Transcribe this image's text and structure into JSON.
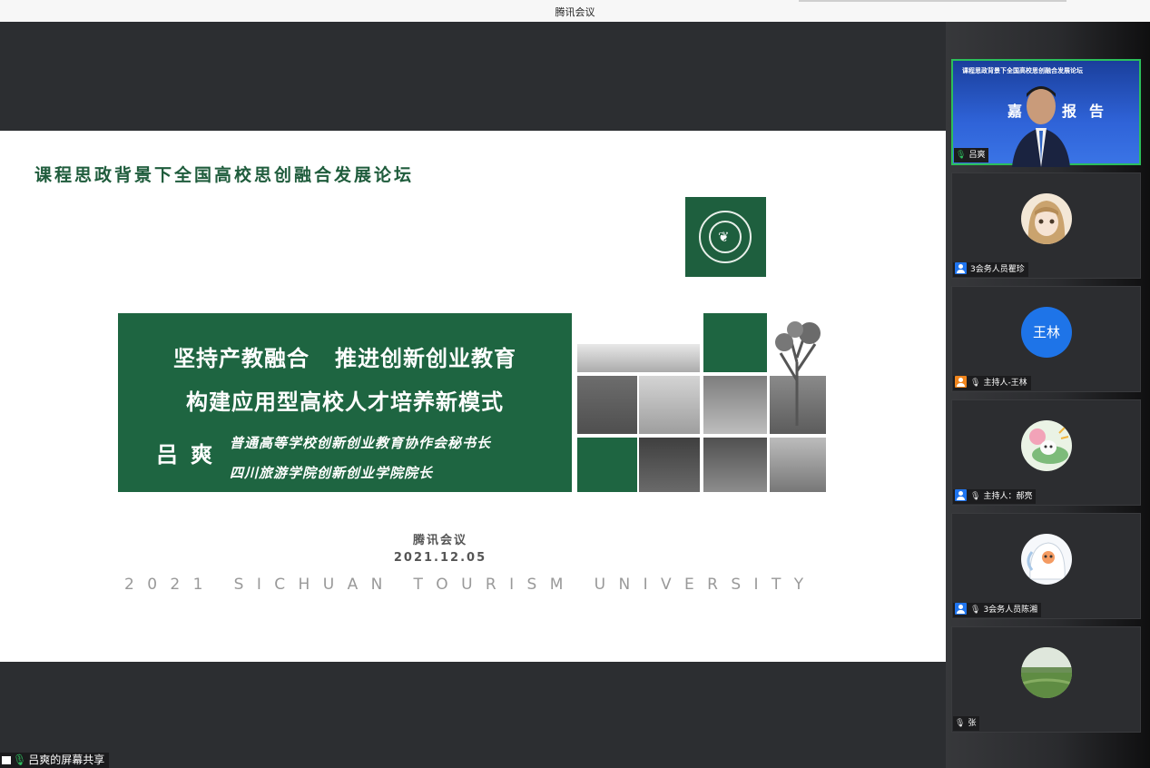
{
  "window": {
    "title": "腾讯会议"
  },
  "slide": {
    "forum_title": "课程思政背景下全国高校思创融合发展论坛",
    "headline_1": "坚持产教融合   推进创新创业教育",
    "headline_2": "构建应用型高校人才培养新模式",
    "speaker": "吕爽",
    "speaker_role_1": "普通高等学校创新创业教育协作会秘书长",
    "speaker_role_2": "四川旅游学院创新创业学院院长",
    "brand": "腾讯会议",
    "date": "2021.12.05",
    "university": "2021 SICHUAN TOURISM UNIVERSITY"
  },
  "share_label": "吕爽的屏幕共享",
  "participants": [
    {
      "name": "吕爽",
      "type": "video",
      "banner_text": "课程思政背景下全国高校思创融合发展论坛",
      "report_text": "嘉宾报告"
    },
    {
      "name": "3会务人员瞿珍",
      "type": "avatar-image",
      "avatar_color": "#c9a77b"
    },
    {
      "name": "主持人-王林",
      "type": "avatar-text",
      "avatar_text": "王林"
    },
    {
      "name": "主持人：郝亮",
      "type": "avatar-image",
      "avatar_color": "#8fc79d"
    },
    {
      "name": "3会务人员陈湘",
      "type": "avatar-image",
      "avatar_color": "#dfe7ef"
    },
    {
      "name": "张",
      "type": "avatar-image",
      "avatar_color": "#6f9b5a"
    }
  ],
  "colors": {
    "active_border": "#2bbf5b",
    "slide_green": "#1e6541",
    "user_badge": "#1f74ee",
    "host_badge": "#f0851d"
  }
}
